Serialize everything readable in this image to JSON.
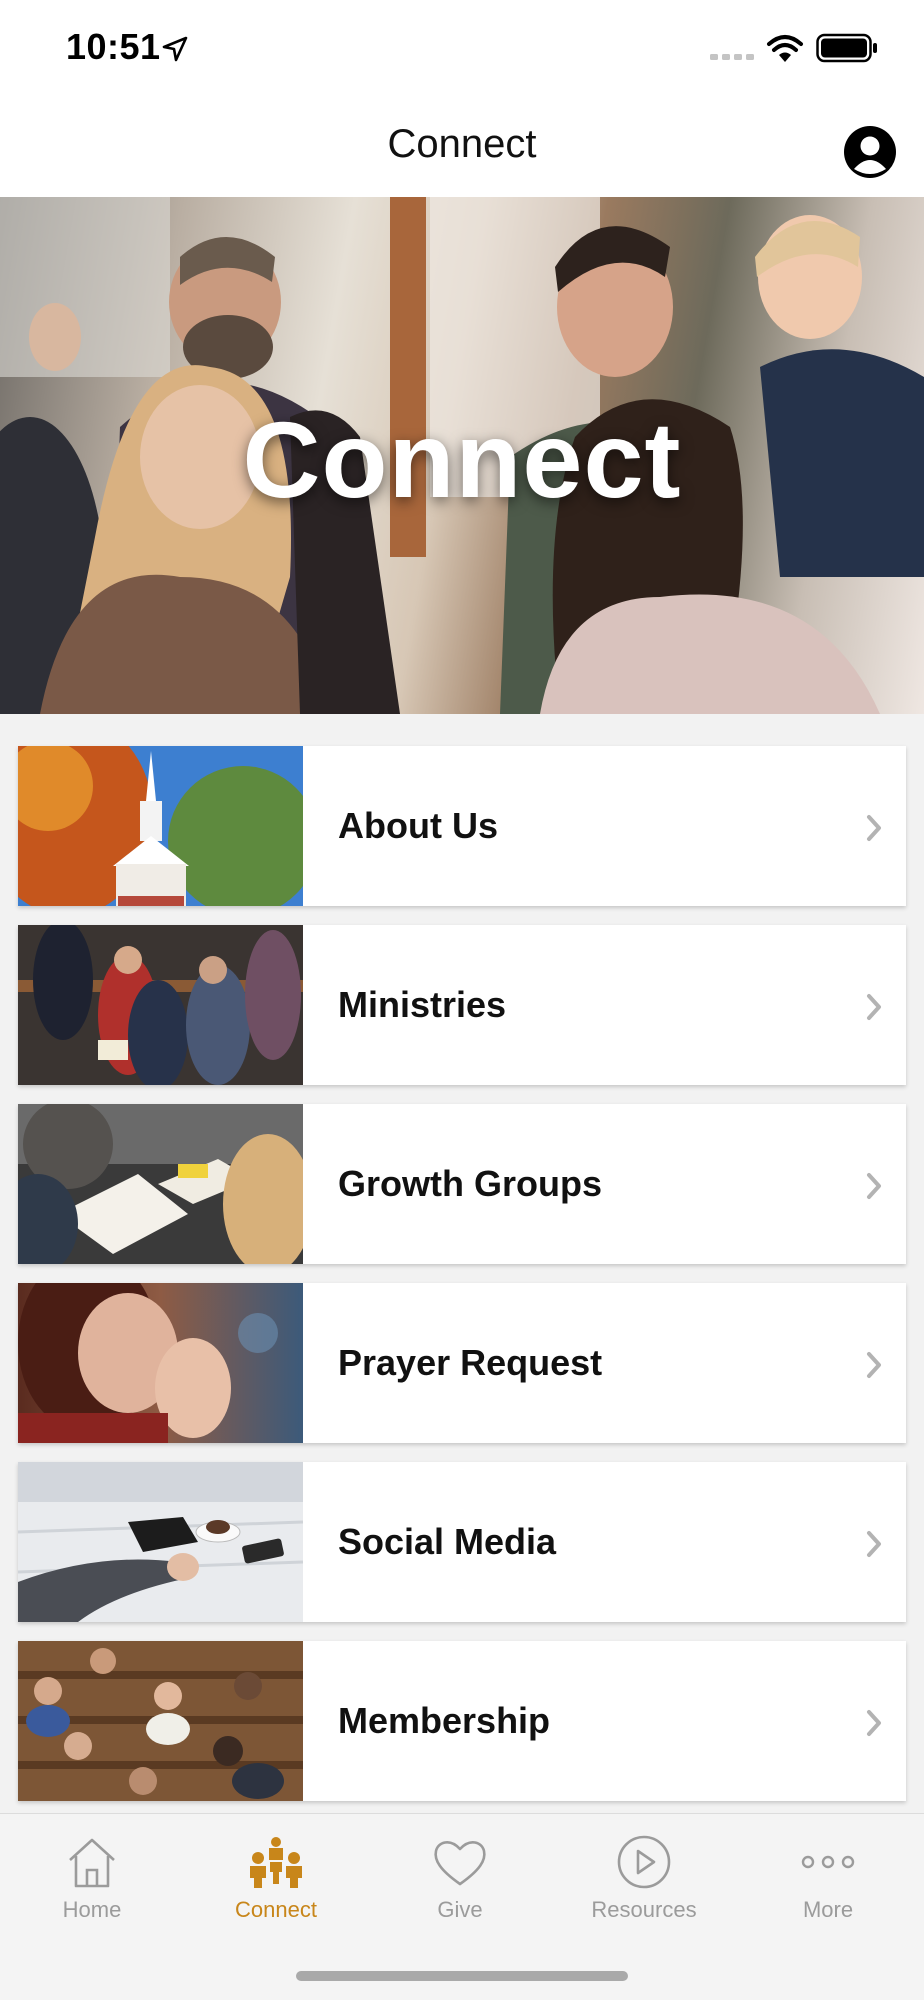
{
  "status_bar": {
    "time": "10:51"
  },
  "nav": {
    "title": "Connect"
  },
  "hero": {
    "title": "Connect"
  },
  "menu": {
    "items": [
      {
        "label": "About Us"
      },
      {
        "label": "Ministries"
      },
      {
        "label": "Growth Groups"
      },
      {
        "label": "Prayer Request"
      },
      {
        "label": "Social Media"
      },
      {
        "label": "Membership"
      }
    ]
  },
  "tab_bar": {
    "active_color": "#c8861a",
    "inactive_color": "#9b9b9b",
    "tabs": [
      {
        "label": "Home",
        "icon": "home-icon"
      },
      {
        "label": "Connect",
        "icon": "people-icon"
      },
      {
        "label": "Give",
        "icon": "heart-icon"
      },
      {
        "label": "Resources",
        "icon": "play-icon"
      },
      {
        "label": "More",
        "icon": "more-icon"
      }
    ]
  }
}
